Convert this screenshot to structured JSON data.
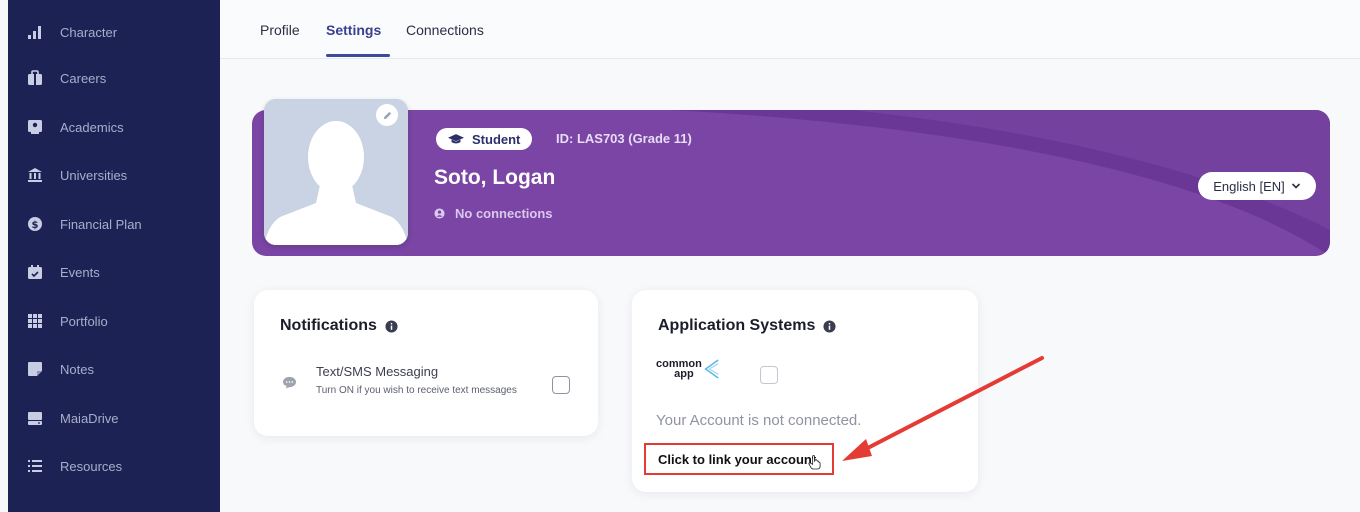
{
  "sidebar": {
    "items": [
      {
        "label": "Character",
        "icon": "bar-chart-icon"
      },
      {
        "label": "Careers",
        "icon": "briefcase-icon"
      },
      {
        "label": "Academics",
        "icon": "book-icon"
      },
      {
        "label": "Universities",
        "icon": "university-icon"
      },
      {
        "label": "Financial Plan",
        "icon": "dollar-icon"
      },
      {
        "label": "Events",
        "icon": "calendar-icon"
      },
      {
        "label": "Portfolio",
        "icon": "grid-icon"
      },
      {
        "label": "Notes",
        "icon": "note-icon"
      },
      {
        "label": "MaiaDrive",
        "icon": "drive-icon"
      },
      {
        "label": "Resources",
        "icon": "list-icon"
      }
    ]
  },
  "tabs": [
    {
      "label": "Profile",
      "active": false
    },
    {
      "label": "Settings",
      "active": true
    },
    {
      "label": "Connections",
      "active": false
    }
  ],
  "profile": {
    "role_badge": "Student",
    "student_id": "ID: LAS703 (Grade 11)",
    "name": "Soto, Logan",
    "connections_text": "No connections",
    "language": "English [EN]"
  },
  "notifications": {
    "title": "Notifications",
    "sms_title": "Text/SMS Messaging",
    "sms_desc": "Turn ON if you wish to receive text messages",
    "sms_checked": false
  },
  "application_systems": {
    "title": "Application Systems",
    "logo_line1": "common",
    "logo_line2": "app",
    "status": "Your Account is not connected.",
    "link_label": "Click to link your account",
    "checked": false
  },
  "colors": {
    "sidebar_bg": "#1d2254",
    "banner_purple": "#7a45a4",
    "accent": "#3d4a9a",
    "annotation_red": "#e53b35"
  }
}
